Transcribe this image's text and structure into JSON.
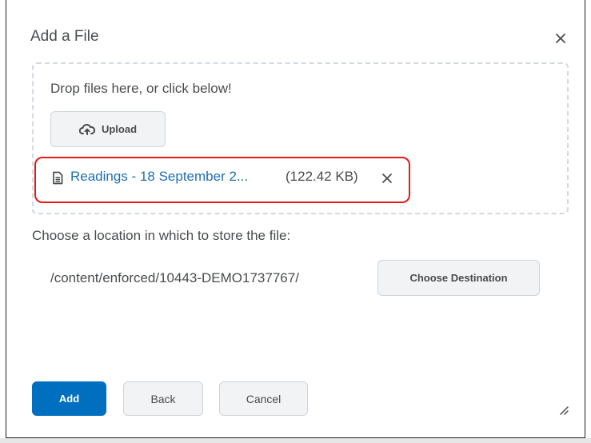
{
  "dialog": {
    "title": "Add a File",
    "close_icon": "close-icon"
  },
  "dropzone": {
    "prompt": "Drop files here, or click below!",
    "upload_label": "Upload",
    "upload_icon": "cloud-upload-icon"
  },
  "selected_file": {
    "icon": "document-icon",
    "name": "Readings - 18 September 2...",
    "size": "(122.42 KB)",
    "remove_icon": "remove-icon",
    "highlight_color": "#e21a1a",
    "link_color": "#1f6fb3"
  },
  "location": {
    "label": "Choose a location in which to store the file:",
    "path": "/content/enforced/10443-DEMO1737767/",
    "choose_label": "Choose Destination"
  },
  "footer": {
    "add_label": "Add",
    "back_label": "Back",
    "cancel_label": "Cancel",
    "primary_color": "#006fbf",
    "resize_icon": "resize-handle-icon"
  }
}
